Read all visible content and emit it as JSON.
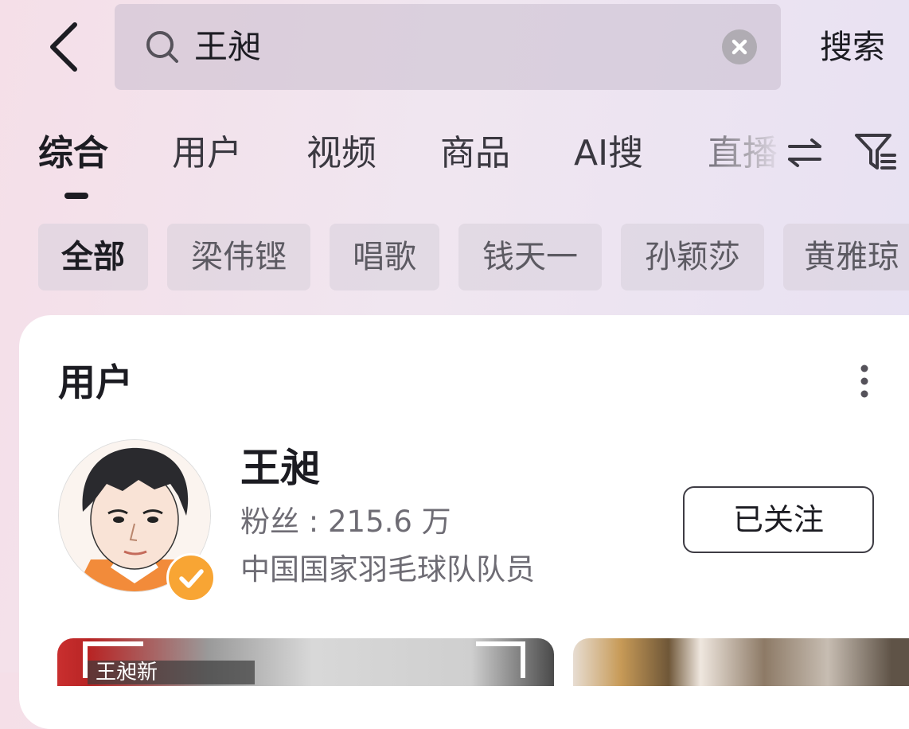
{
  "search": {
    "query": "王昶",
    "submit_label": "搜索"
  },
  "tabs": [
    {
      "label": "综合",
      "active": true
    },
    {
      "label": "用户",
      "active": false
    },
    {
      "label": "视频",
      "active": false
    },
    {
      "label": "商品",
      "active": false
    },
    {
      "label": "AI搜",
      "active": false
    },
    {
      "label": "直播",
      "active": false
    }
  ],
  "chips": [
    {
      "label": "全部",
      "active": true
    },
    {
      "label": "梁伟铿",
      "active": false
    },
    {
      "label": "唱歌",
      "active": false
    },
    {
      "label": "钱天一",
      "active": false
    },
    {
      "label": "孙颖莎",
      "active": false
    },
    {
      "label": "黄雅琼",
      "active": false
    }
  ],
  "user_section": {
    "title": "用户",
    "user": {
      "name": "王昶",
      "fans": "粉丝 : 215.6 万",
      "description": "中国国家羽毛球队队员",
      "verified": true,
      "follow_label": "已关注"
    }
  },
  "thumbnails": [
    {
      "caption": "王昶新"
    },
    {
      "caption": ""
    }
  ],
  "icons": {
    "back": "chevron-left-icon",
    "search": "search-icon",
    "clear": "clear-icon",
    "swap": "swap-icon",
    "filter": "filter-icon",
    "more": "more-vertical-icon",
    "verified": "verified-check-icon"
  },
  "colors": {
    "accent_badge": "#f8a534",
    "text_primary": "#1c1c22",
    "text_secondary": "#6e6c74"
  }
}
